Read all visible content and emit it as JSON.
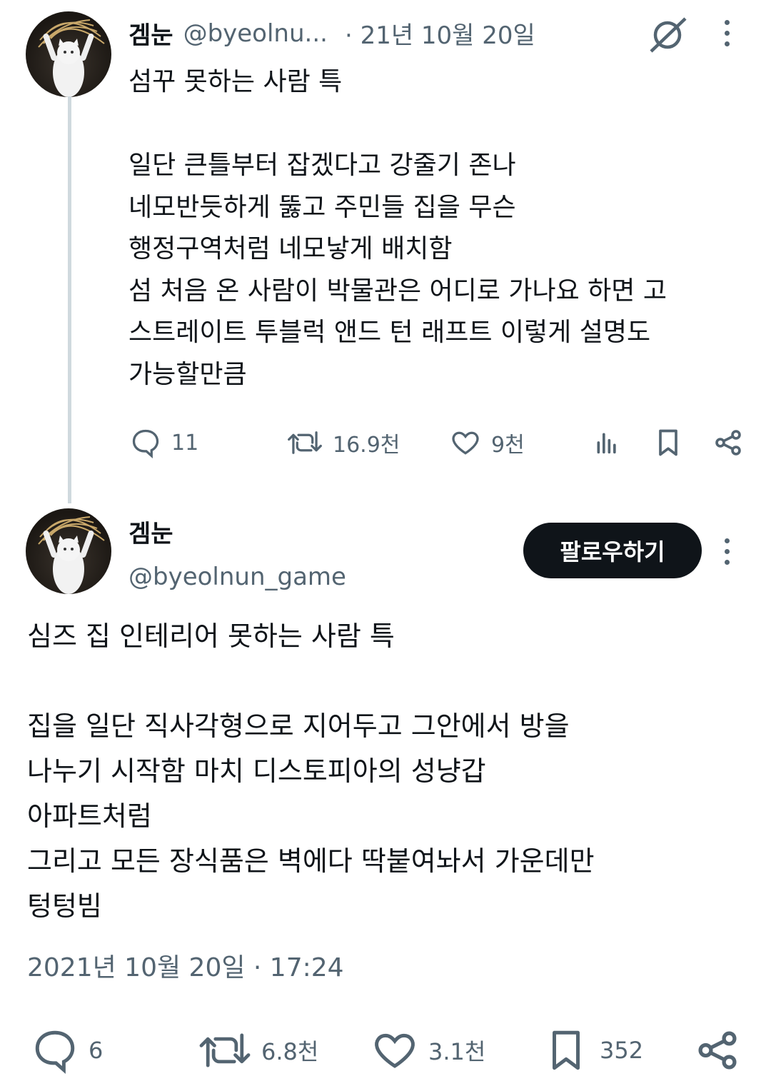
{
  "parent_tweet": {
    "display_name": "겜눈",
    "handle": "@byeolnu...",
    "date": "· 21년 10월 20일",
    "text": "섬꾸 못하는 사람 특\n\n일단 큰틀부터 잡겠다고 강줄기 존나\n네모반듯하게 뚫고 주민들 집을 무슨\n행정구역처럼 네모낳게 배치함\n섬 처음 온 사람이 박물관은 어디로 가나요 하면 고\n스트레이트 투블럭 앤드 턴 래프트 이렇게 설명도\n가능할만큼",
    "replies": "11",
    "retweets": "16.9천",
    "likes": "9천",
    "icons": [
      "slash-circle-icon",
      "more-icon",
      "reply-icon",
      "retweet-icon",
      "like-icon",
      "views-icon",
      "bookmark-icon",
      "share-icon"
    ]
  },
  "main_tweet": {
    "display_name": "겜눈",
    "handle": "@byeolnun_game",
    "follow_label": "팔로우하기",
    "text": "심즈 집 인테리어 못하는 사람 특\n\n집을 일단 직사각형으로 지어두고 그안에서 방을\n나누기 시작함 마치 디스토피아의 성냥갑\n아파트처럼\n그리고 모든 장식품은 벽에다 딱붙여놔서 가운데만\n텅텅빔",
    "timestamp": "2021년 10월 20일 · 17:24",
    "replies": "6",
    "retweets": "6.8천",
    "likes": "3.1천",
    "bookmarks": "352"
  },
  "colors": {
    "text": "#0f1419",
    "muted": "#536471",
    "thread_line": "#cfd9de",
    "button_bg": "#0f1419"
  }
}
